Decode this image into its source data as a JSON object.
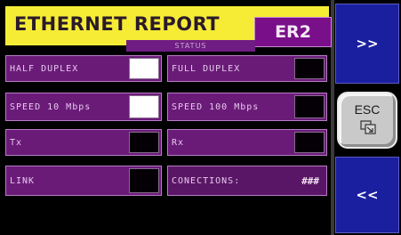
{
  "header": {
    "title": "ETHERNET REPORT",
    "code": "ER2",
    "status": "STATUS"
  },
  "rows": {
    "half_duplex": {
      "label": "HALF DUPLEX",
      "active": true
    },
    "full_duplex": {
      "label": "FULL DUPLEX",
      "active": false
    },
    "speed_10": {
      "label": "SPEED 10 Mbps",
      "active": true
    },
    "speed_100": {
      "label": "SPEED 100 Mbps",
      "active": false
    },
    "tx": {
      "label": "Tx",
      "active": false
    },
    "rx": {
      "label": "Rx",
      "active": false
    },
    "link": {
      "label": "LINK",
      "active": false
    },
    "connections": {
      "label": "CONECTIONS:",
      "value": "###"
    }
  },
  "nav": {
    "next_label": ">>",
    "esc_label": "ESC",
    "prev_label": "<<"
  },
  "colors": {
    "header_bg": "#f6ec36",
    "cell_bg": "#6a1b78",
    "nav_bg": "#1a1fa0",
    "esc_bg": "#c9c9c9"
  },
  "icons": {
    "esc": "window-exit-icon"
  }
}
